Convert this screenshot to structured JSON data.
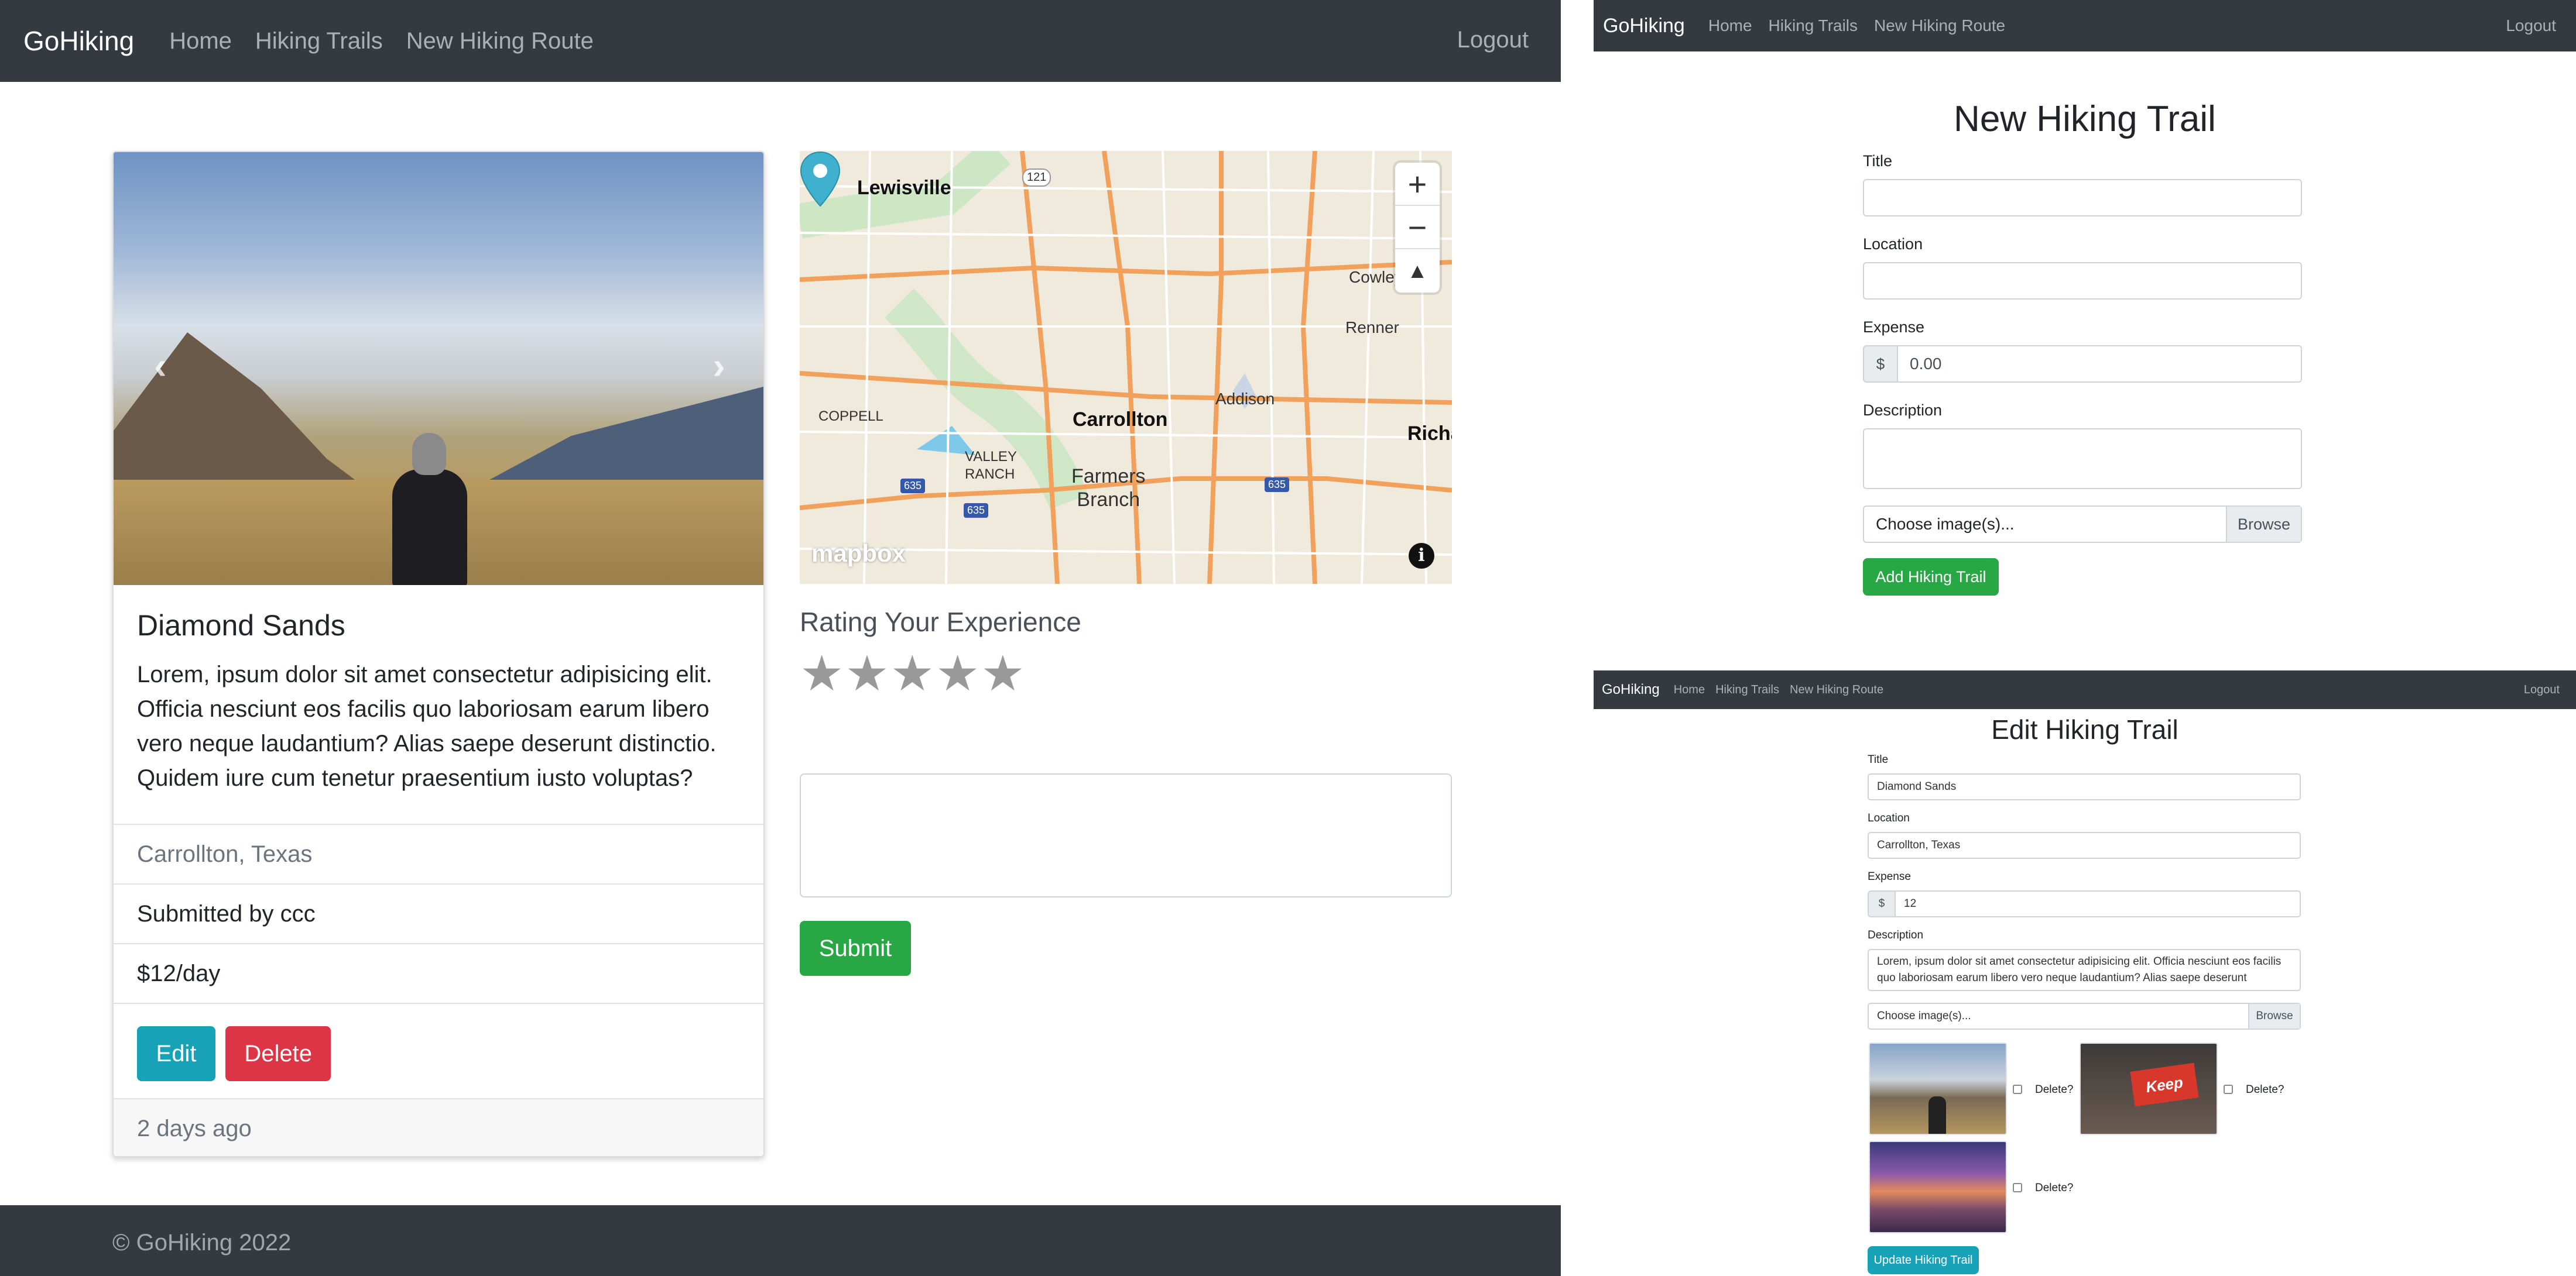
{
  "show_page": {
    "navbar": {
      "brand": "GoHiking",
      "links": [
        "Home",
        "Hiking Trails",
        "New Hiking Route"
      ],
      "logout": "Logout"
    },
    "carousel": {
      "prev_icon": "chevron-left-icon",
      "next_icon": "chevron-right-icon"
    },
    "card": {
      "title": "Diamond Sands",
      "description": "Lorem, ipsum dolor sit amet consectetur adipisicing elit. Officia nesciunt eos facilis quo laboriosam earum libero vero neque laudantium? Alias saepe deserunt distinctio. Quidem iure cum tenetur praesentium iusto voluptas?",
      "location": "Carrollton, Texas",
      "submitted_by": "Submitted by ccc",
      "price": "$12/day",
      "edit_label": "Edit",
      "delete_label": "Delete",
      "footer": "2 days ago"
    },
    "map": {
      "labels": {
        "lewisville": "Lewisville",
        "cowley": "Cowley",
        "renner": "Renner",
        "addison": "Addison",
        "carrollton": "Carrollton",
        "coppell": "COPPELL",
        "valley_ranch": "VALLEY\nRANCH",
        "farmers_branch": "Farmers\nBranch",
        "richardson_partial": "Richa",
        "hwy_121": "121",
        "hwy_635": "635"
      },
      "zoom_in": "+",
      "zoom_out": "−",
      "compass": "▲",
      "attribution_logo": "mapbox",
      "info": "i"
    },
    "review": {
      "title": "Rating Your Experience",
      "stars": 5,
      "star_glyph": "★",
      "submit_label": "Submit"
    },
    "footer": "© GoHiking 2022"
  },
  "new_page": {
    "navbar": {
      "brand": "GoHiking",
      "links": [
        "Home",
        "Hiking Trails",
        "New Hiking Route"
      ],
      "logout": "Logout"
    },
    "title": "New Hiking Trail",
    "labels": {
      "title": "Title",
      "location": "Location",
      "expense": "Expense",
      "description": "Description"
    },
    "expense_addon": "$",
    "expense_placeholder": "0.00",
    "file_placeholder": "Choose image(s)...",
    "file_browse": "Browse",
    "submit_label": "Add Hiking Trail"
  },
  "edit_page": {
    "navbar": {
      "brand": "GoHiking",
      "links": [
        "Home",
        "Hiking Trails",
        "New Hiking Route"
      ],
      "logout": "Logout"
    },
    "title": "Edit Hiking Trail",
    "labels": {
      "title": "Title",
      "location": "Location",
      "expense": "Expense",
      "description": "Description"
    },
    "values": {
      "title": "Diamond Sands",
      "location": "Carrollton, Texas",
      "expense": "12",
      "description": "Lorem, ipsum dolor sit amet consectetur adipisicing elit. Officia nesciunt eos facilis quo laboriosam earum libero vero neque laudantium? Alias saepe deserunt"
    },
    "expense_addon": "$",
    "file_placeholder": "Choose image(s)...",
    "file_browse": "Browse",
    "delete_label": "Delete?",
    "thumb_text": "Keep",
    "submit_label": "Update Hiking Trail"
  },
  "colors": {
    "navbar": "#343a40",
    "info": "#17a2b8",
    "danger": "#dc3545",
    "success": "#28a745",
    "star": "#999999"
  }
}
